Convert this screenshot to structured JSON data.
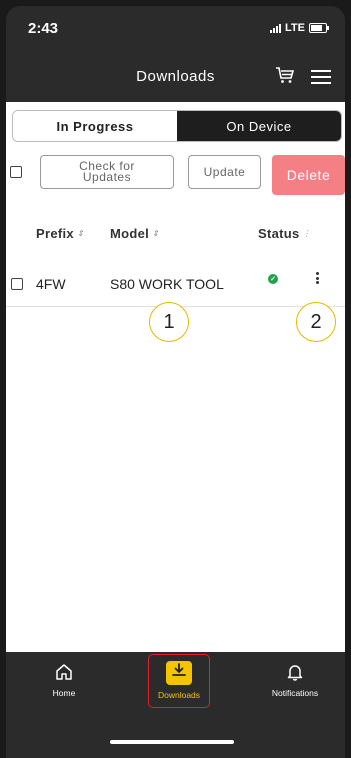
{
  "status_bar": {
    "time": "2:43",
    "network": "LTE"
  },
  "header": {
    "title": "Downloads"
  },
  "tabs": [
    {
      "label": "In Progress",
      "active": true
    },
    {
      "label": "On Device",
      "active": false
    }
  ],
  "toolbar": {
    "check_updates_label": "Check for Updates",
    "update_label": "Update",
    "delete_label": "Delete"
  },
  "columns": {
    "prefix": "Prefix",
    "model": "Model",
    "status": "Status"
  },
  "rows": [
    {
      "prefix": "4FW",
      "model": "S80 WORK TOOL",
      "status": "ok"
    }
  ],
  "callouts": [
    "1",
    "2"
  ],
  "bottom_nav": {
    "home": "Home",
    "downloads": "Downloads",
    "notifications": "Notifications"
  },
  "colors": {
    "delete_button": "#f47f84",
    "downloads_accent": "#f5c400",
    "status_ok": "#22a04a",
    "highlight_border": "#e0202a",
    "callout_border": "#e6b800"
  }
}
